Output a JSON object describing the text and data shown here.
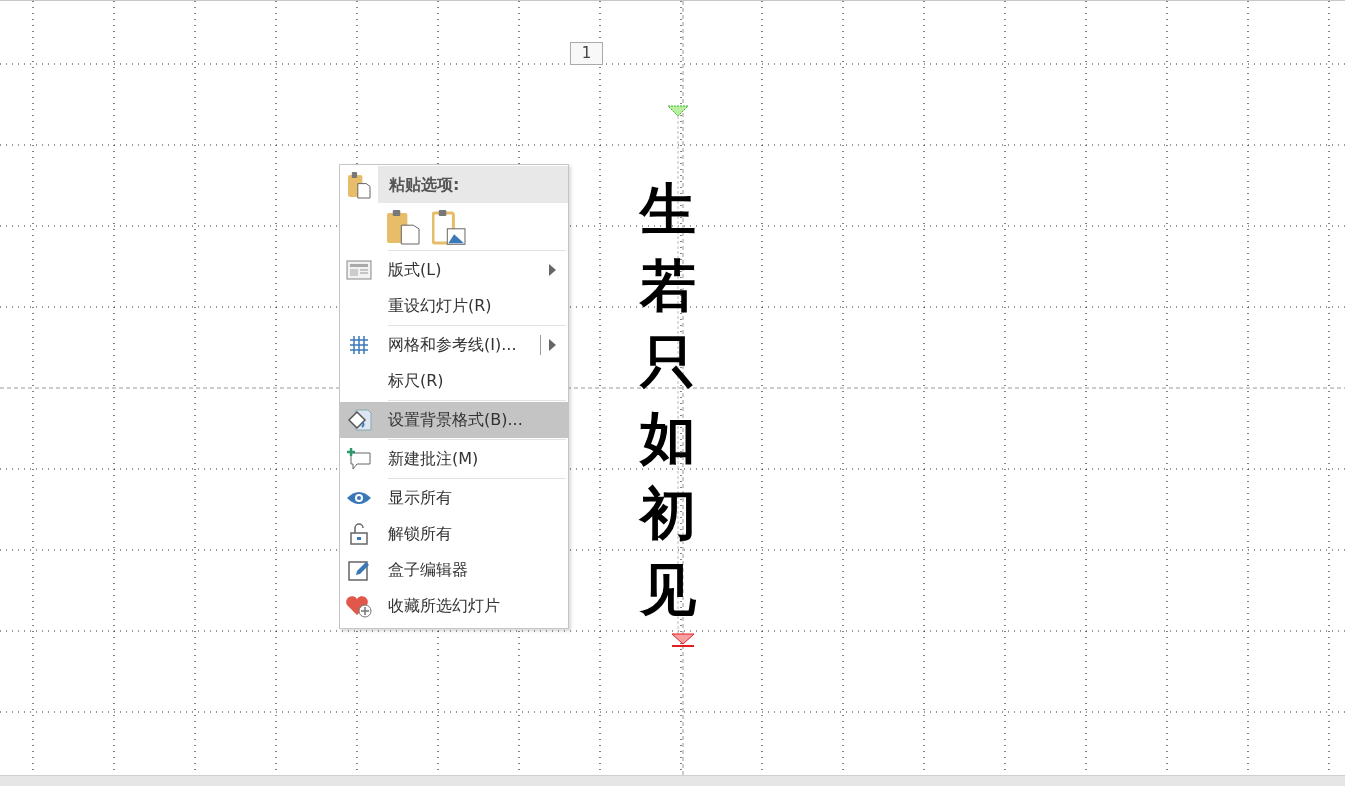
{
  "slide": {
    "number": "1",
    "vertical_text": "生若只如初见"
  },
  "context_menu": {
    "paste_header": "粘贴选项:",
    "paste_options": [
      {
        "kind": "keep"
      },
      {
        "kind": "picture"
      }
    ],
    "groups": [
      [
        {
          "label": "版式(L)",
          "kind": "layout",
          "submenu": true,
          "split": false,
          "selected": false
        },
        {
          "label": "重设幻灯片(R)",
          "kind": "plain",
          "submenu": false,
          "split": false,
          "selected": false
        }
      ],
      [
        {
          "label": "网格和参考线(I)...",
          "kind": "grid",
          "submenu": true,
          "split": true,
          "selected": false
        },
        {
          "label": "标尺(R)",
          "kind": "plain",
          "submenu": false,
          "split": false,
          "selected": false
        }
      ],
      [
        {
          "label": "设置背景格式(B)...",
          "kind": "background",
          "submenu": false,
          "split": false,
          "selected": true
        }
      ],
      [
        {
          "label": "新建批注(M)",
          "kind": "comment",
          "submenu": false,
          "split": false,
          "selected": false
        }
      ],
      [
        {
          "label": "显示所有",
          "kind": "eye",
          "submenu": false,
          "split": false,
          "selected": false
        },
        {
          "label": "解锁所有",
          "kind": "lock",
          "submenu": false,
          "split": false,
          "selected": false
        },
        {
          "label": "盒子编辑器",
          "kind": "edit",
          "submenu": false,
          "split": false,
          "selected": false
        },
        {
          "label": "收藏所选幻灯片",
          "kind": "heart",
          "submenu": false,
          "split": false,
          "selected": false
        }
      ]
    ]
  }
}
